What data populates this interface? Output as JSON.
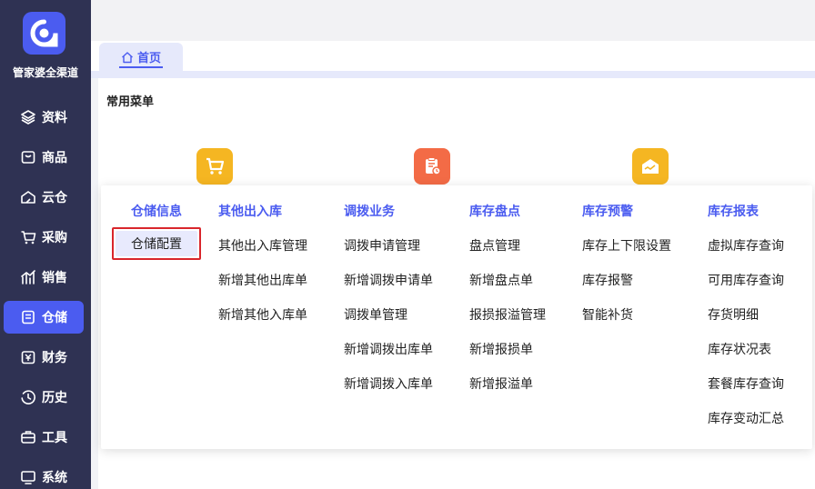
{
  "brand": {
    "name": "管家婆全渠道"
  },
  "sidebar": {
    "items": [
      {
        "label": "资料",
        "icon": "layers-icon"
      },
      {
        "label": "商品",
        "icon": "box-icon"
      },
      {
        "label": "云仓",
        "icon": "cloud-warehouse-icon"
      },
      {
        "label": "采购",
        "icon": "cart-icon"
      },
      {
        "label": "销售",
        "icon": "bar-chart-icon"
      },
      {
        "label": "仓储",
        "icon": "storage-icon",
        "active": true
      },
      {
        "label": "财务",
        "icon": "finance-icon"
      },
      {
        "label": "历史",
        "icon": "history-icon"
      },
      {
        "label": "工具",
        "icon": "toolbox-icon"
      },
      {
        "label": "系统",
        "icon": "monitor-icon"
      }
    ]
  },
  "tabs": [
    {
      "label": "首页",
      "icon": "home-icon"
    }
  ],
  "main": {
    "section_title": "常用菜单",
    "quick_icons": [
      {
        "icon": "cart-icon",
        "color": "#f5b622"
      },
      {
        "icon": "clipboard-clock-icon",
        "color": "#f36b46"
      },
      {
        "icon": "envelope-chart-icon",
        "color": "#f5b622"
      }
    ]
  },
  "menu": {
    "columns": [
      {
        "title": "仓储信息",
        "items": [
          "仓储配置"
        ]
      },
      {
        "title": "其他出入库",
        "items": [
          "其他出入库管理",
          "新增其他出库单",
          "新增其他入库单"
        ]
      },
      {
        "title": "调拨业务",
        "items": [
          "调拨申请管理",
          "新增调拨申请单",
          "调拨单管理",
          "新增调拨出库单",
          "新增调拨入库单"
        ]
      },
      {
        "title": "库存盘点",
        "items": [
          "盘点管理",
          "新增盘点单",
          "报损报溢管理",
          "新增报损单",
          "新增报溢单"
        ]
      },
      {
        "title": "库存预警",
        "items": [
          "库存上下限设置",
          "库存报警",
          "智能补货"
        ]
      },
      {
        "title": "库存报表",
        "items": [
          "虚拟库存查询",
          "可用库存查询",
          "存货明细",
          "库存状况表",
          "套餐库存查询",
          "库存变动汇总"
        ]
      }
    ]
  }
}
